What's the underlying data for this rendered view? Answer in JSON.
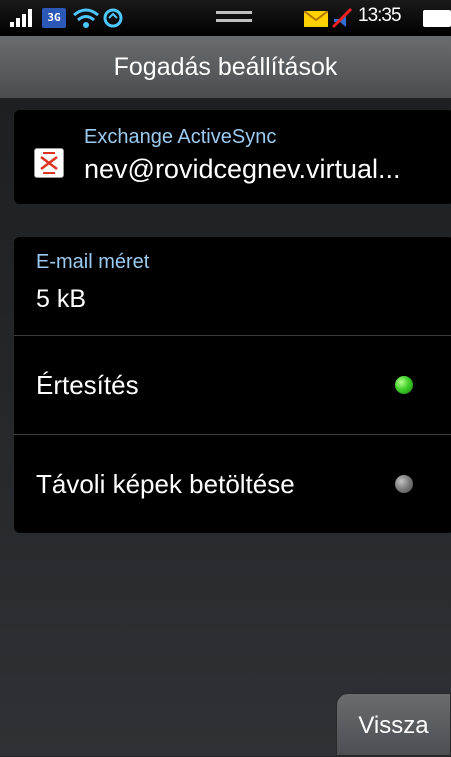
{
  "status_bar": {
    "network": "3G",
    "time": "13:35",
    "icons": [
      "signal-icon",
      "3g-icon",
      "wifi-icon",
      "sync-icon",
      "handle-icon",
      "mail-icon",
      "mute-icon",
      "battery-icon"
    ]
  },
  "header": {
    "title": "Fogadás beállítások"
  },
  "account": {
    "type": "Exchange ActiveSync",
    "email": "nev@rovidcegnev.virtual..."
  },
  "settings": {
    "email_size": {
      "label": "E-mail méret",
      "value": "5 kB"
    },
    "notification": {
      "label": "Értesítés",
      "enabled": true
    },
    "remote_images": {
      "label": "Távoli képek betöltése",
      "enabled": false
    }
  },
  "footer": {
    "back_label": "Vissza"
  },
  "colors": {
    "accent_label": "#9ccbf0",
    "toggle_on": "#3fcf28",
    "toggle_off": "#7a7a7a",
    "panel_bg": "#000000"
  }
}
